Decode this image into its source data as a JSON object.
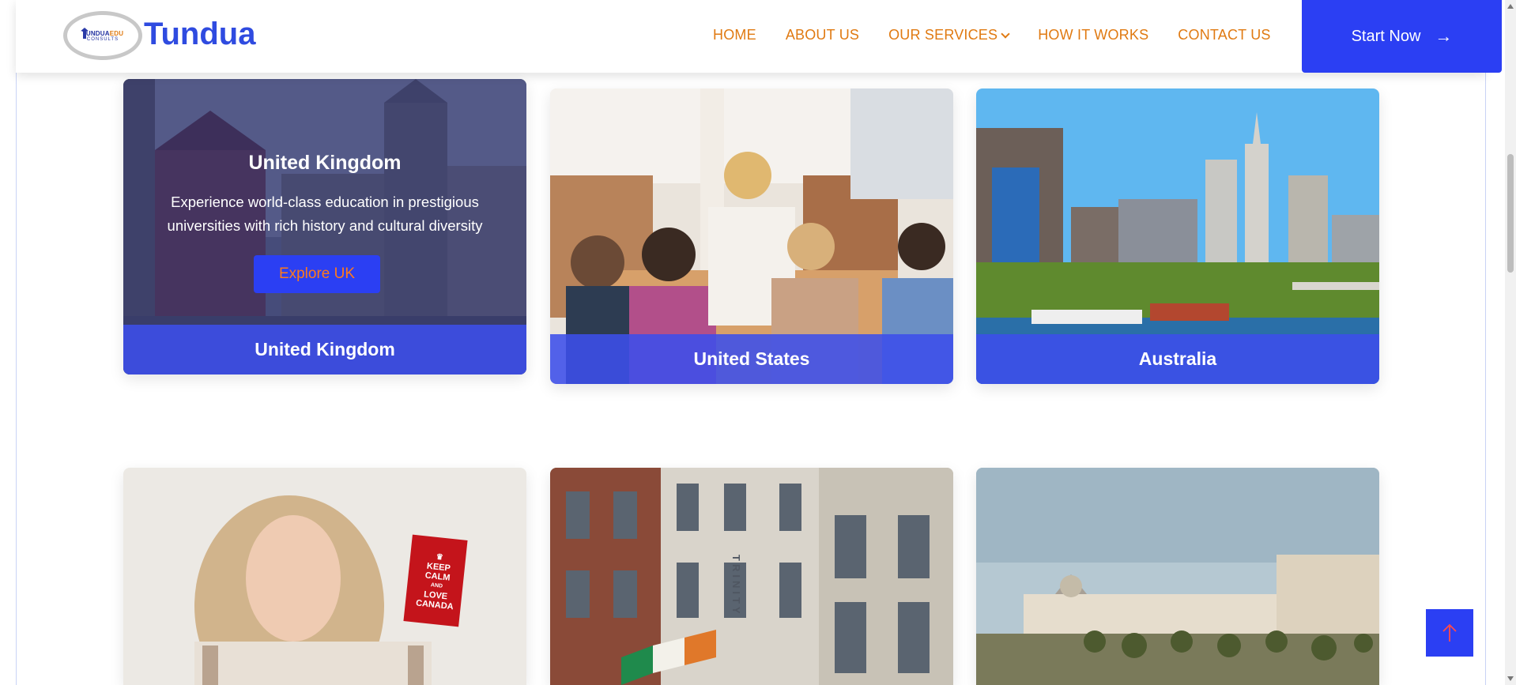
{
  "header": {
    "logo_badge_main": "TUNDUA",
    "logo_badge_accent": "EDU",
    "logo_badge_sub": "CONSULTS",
    "logo_text": "Tundua",
    "nav": [
      {
        "label": "HOME"
      },
      {
        "label": "ABOUT US"
      },
      {
        "label": "OUR SERVICES",
        "has_dropdown": true
      },
      {
        "label": "HOW IT WORKS"
      },
      {
        "label": "CONTACT US"
      }
    ],
    "start_button": {
      "label": "Start Now",
      "icon": "arrow-right-icon"
    }
  },
  "destinations": [
    {
      "caption": "United Kingdom",
      "hovered": true,
      "overlay_title": "United Kingdom",
      "overlay_description": "Experience world-class education in prestigious universities with rich history and cultural diversity",
      "overlay_button": "Explore UK"
    },
    {
      "caption": "United States"
    },
    {
      "caption": "Australia"
    },
    {
      "caption": ""
    },
    {
      "caption": ""
    },
    {
      "caption": ""
    }
  ],
  "canada_card": {
    "sign_l1": "KEEP",
    "sign_l2": "CALM",
    "sign_l3": "AND",
    "sign_l4": "LOVE",
    "sign_l5": "CANADA"
  },
  "ireland_card": {
    "building_text": "TRINITY"
  },
  "scroll_to_top": {
    "icon": "arrow-up-icon"
  },
  "colors": {
    "brand_blue": "#2b3ff3",
    "nav_orange": "#e07a12",
    "caption_blue": "#3c4eeb"
  }
}
